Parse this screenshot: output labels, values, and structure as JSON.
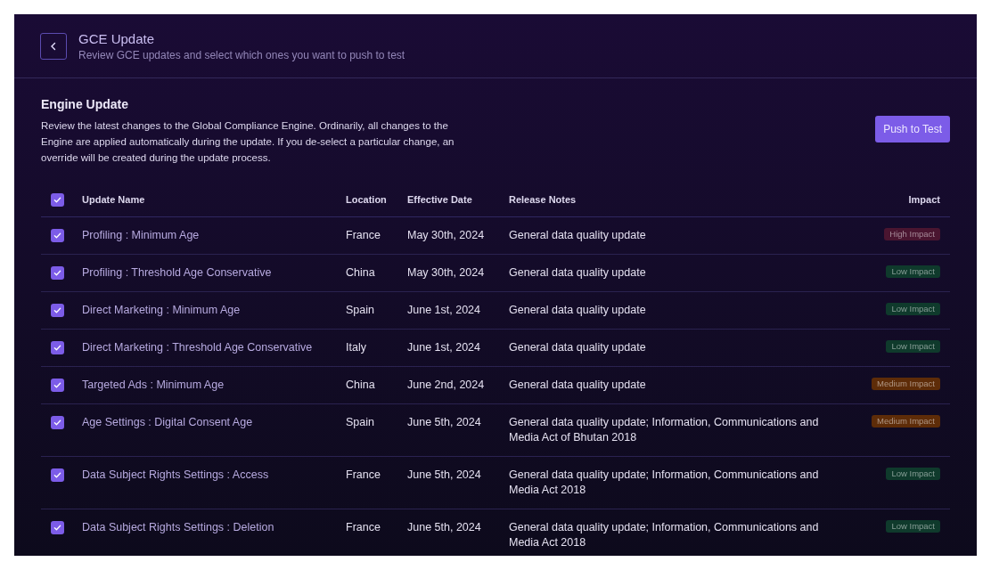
{
  "header": {
    "title": "GCE Update",
    "subtitle": "Review GCE updates and select which ones you want to push to test"
  },
  "section": {
    "title": "Engine Update",
    "description": "Review the latest changes to the Global Compliance Engine. Ordinarily, all changes to the Engine are applied automatically during the update.  If you de-select a particular change, an override will be created during the update process.",
    "button": "Push to Test"
  },
  "table": {
    "all_checked": true,
    "columns": [
      "Update Name",
      "Location",
      "Effective Date",
      "Release Notes",
      "Impact"
    ],
    "rows": [
      {
        "checked": true,
        "name": "Profiling : Minimum Age",
        "location": "France",
        "date": "May 30th, 2024",
        "notes": "General data quality update",
        "impact": "High Impact",
        "color": "#4a1530"
      },
      {
        "checked": true,
        "name": "Profiling : Threshold Age Conservative",
        "location": "China",
        "date": "May 30th, 2024",
        "notes": "General data quality update",
        "impact": "Low Impact",
        "color": "#0f3a2c"
      },
      {
        "checked": true,
        "name": "Direct Marketing : Minimum Age",
        "location": "Spain",
        "date": "June 1st, 2024",
        "notes": "General data quality update",
        "impact": "Low Impact",
        "color": "#0f3a2c"
      },
      {
        "checked": true,
        "name": "Direct Marketing : Threshold Age Conservative",
        "location": "Italy",
        "date": "June 1st, 2024",
        "notes": "General data quality update",
        "impact": "Low Impact",
        "color": "#0f3a2c"
      },
      {
        "checked": true,
        "name": "Targeted Ads : Minimum Age",
        "location": "China",
        "date": "June 2nd, 2024",
        "notes": "General data quality update",
        "impact": "Medium Impact",
        "color": "#5e2c08"
      },
      {
        "checked": true,
        "name": "Age Settings : Digital Consent Age",
        "location": "Spain",
        "date": "June 5th, 2024",
        "notes": "General data quality update; Information, Communications and Media Act of Bhutan 2018",
        "impact": "Medium Impact",
        "color": "#5e2c08"
      },
      {
        "checked": true,
        "name": "Data Subject Rights Settings : Access",
        "location": "France",
        "date": "June 5th, 2024",
        "notes": "General data quality update; Information, Communications and Media Act 2018",
        "impact": "Low Impact",
        "color": "#0f3a2c"
      },
      {
        "checked": true,
        "name": "Data Subject Rights Settings : Deletion",
        "location": "France",
        "date": "June 5th, 2024",
        "notes": "General data quality update; Information, Communications and Media Act 2018",
        "impact": "Low Impact",
        "color": "#0f3a2c"
      }
    ]
  }
}
